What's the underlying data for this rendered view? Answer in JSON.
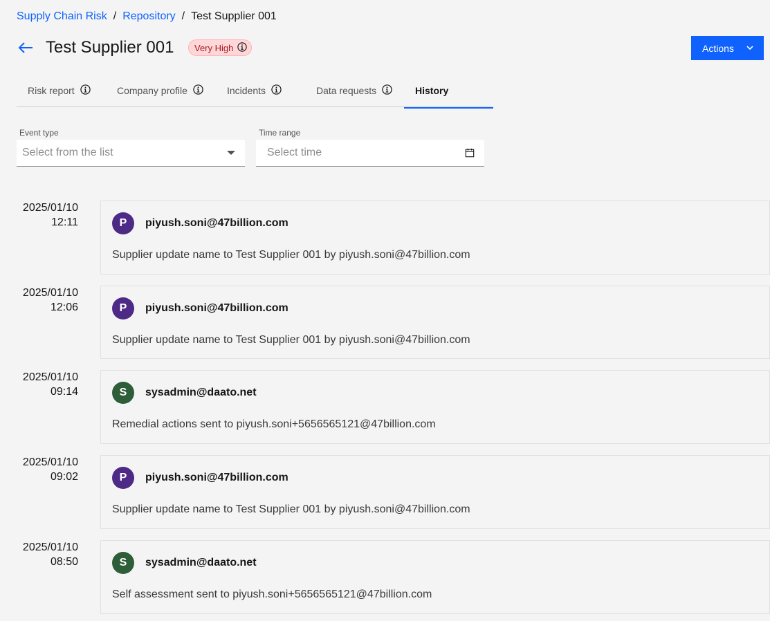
{
  "breadcrumb": {
    "items": [
      "Supply Chain Risk",
      "Repository"
    ],
    "separator": "/",
    "current": "Test Supplier 001"
  },
  "header": {
    "title": "Test Supplier 001",
    "risk_badge": "Very High",
    "actions_label": "Actions"
  },
  "tabs": [
    {
      "label": "Risk report",
      "has_info": true
    },
    {
      "label": "Company profile",
      "has_info": true
    },
    {
      "label": "Incidents",
      "has_info": true
    },
    {
      "label": "Data requests",
      "has_info": true
    },
    {
      "label": "History",
      "has_info": false,
      "active": true
    }
  ],
  "filters": {
    "event_type": {
      "label": "Event type",
      "placeholder": "Select from the list"
    },
    "time_range": {
      "label": "Time range",
      "placeholder": "Select time"
    }
  },
  "colors": {
    "primary": "#0f62fe",
    "avatar_p": "#4c2a85",
    "avatar_s": "#2e5d3a",
    "badge_bg": "#ffd7d9",
    "badge_text": "#a2191f"
  },
  "history": [
    {
      "date": "2025/01/10",
      "time": "12:11",
      "avatar": "P",
      "avatar_color": "#4c2a85",
      "user": "piyush.soni@47billion.com",
      "message": "Supplier update name to Test Supplier 001 by piyush.soni@47billion.com"
    },
    {
      "date": "2025/01/10",
      "time": "12:06",
      "avatar": "P",
      "avatar_color": "#4c2a85",
      "user": "piyush.soni@47billion.com",
      "message": "Supplier update name to Test Supplier 001 by piyush.soni@47billion.com"
    },
    {
      "date": "2025/01/10",
      "time": "09:14",
      "avatar": "S",
      "avatar_color": "#2e5d3a",
      "user": "sysadmin@daato.net",
      "message": "Remedial actions sent to piyush.soni+5656565121@47billion.com"
    },
    {
      "date": "2025/01/10",
      "time": "09:02",
      "avatar": "P",
      "avatar_color": "#4c2a85",
      "user": "piyush.soni@47billion.com",
      "message": "Supplier update name to Test Supplier 001 by piyush.soni@47billion.com"
    },
    {
      "date": "2025/01/10",
      "time": "08:50",
      "avatar": "S",
      "avatar_color": "#2e5d3a",
      "user": "sysadmin@daato.net",
      "message": "Self assessment sent to piyush.soni+5656565121@47billion.com"
    }
  ]
}
